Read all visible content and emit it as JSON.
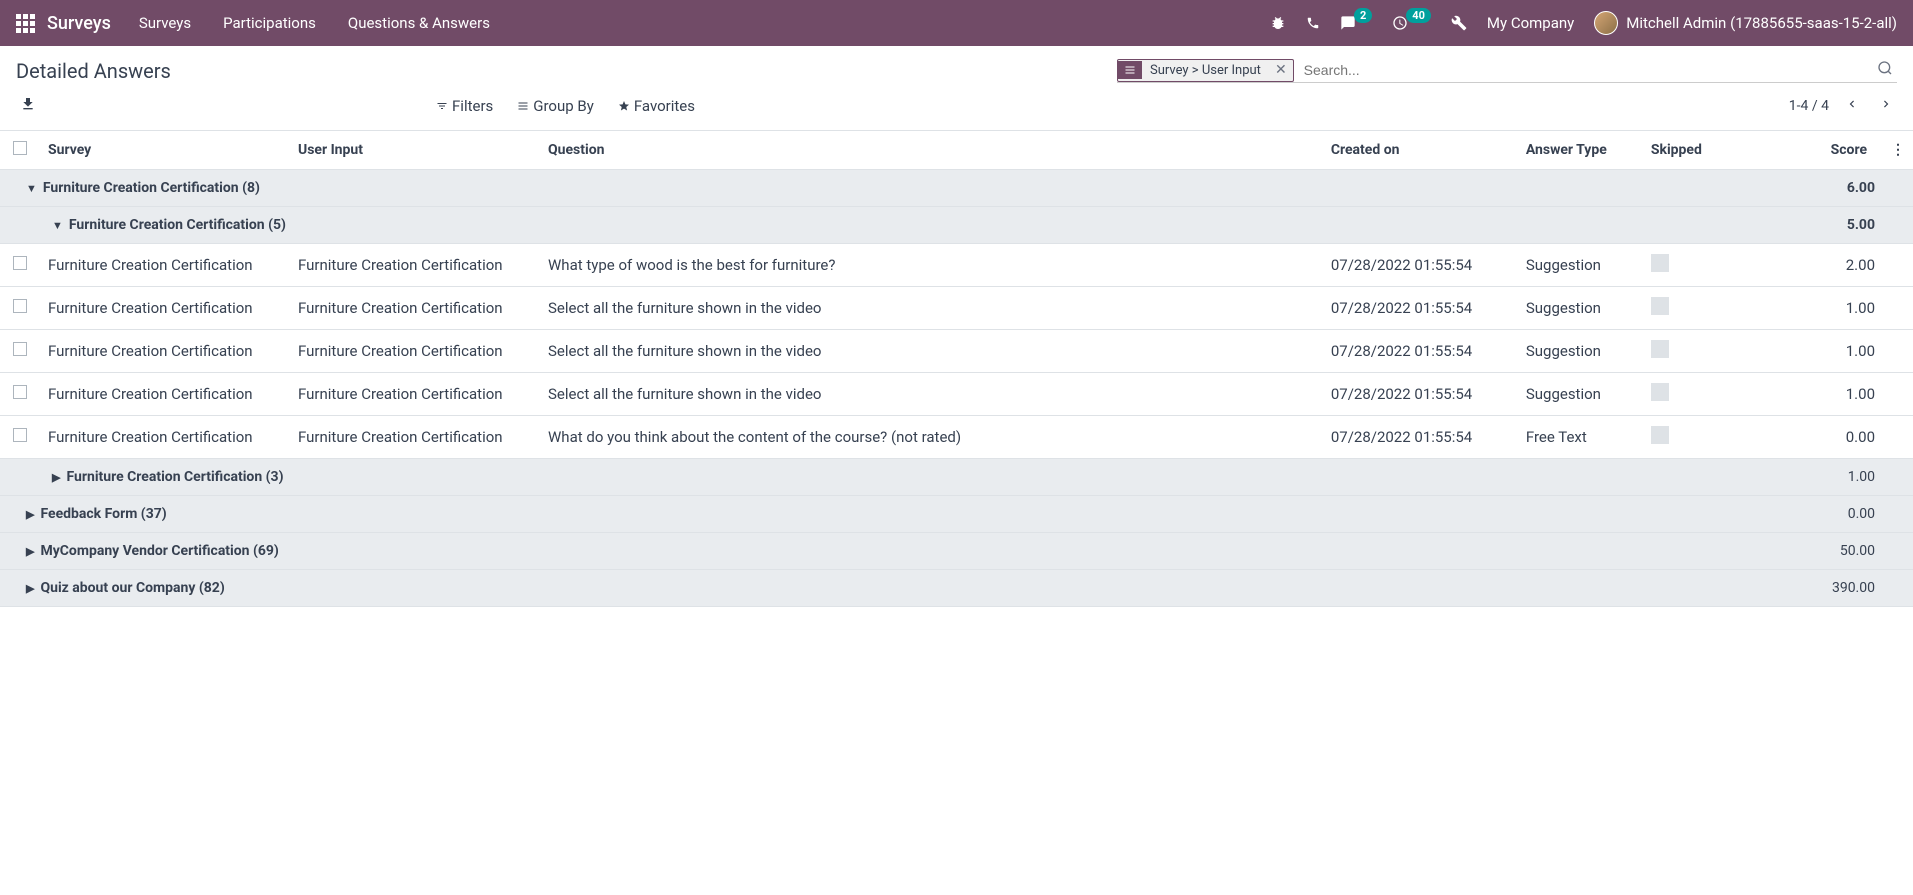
{
  "nav": {
    "brand": "Surveys",
    "items": [
      "Surveys",
      "Participations",
      "Questions & Answers"
    ],
    "messages_badge": "2",
    "activities_badge": "40",
    "company": "My Company",
    "user": "Mitchell Admin (17885655-saas-15-2-all)"
  },
  "cp": {
    "title": "Detailed Answers",
    "facet": "Survey > User Input",
    "search_placeholder": "Search...",
    "filters": "Filters",
    "groupby": "Group By",
    "favorites": "Favorites",
    "pager": "1-4 / 4"
  },
  "columns": {
    "survey": "Survey",
    "user_input": "User Input",
    "question": "Question",
    "created": "Created on",
    "answer_type": "Answer Type",
    "skipped": "Skipped",
    "score": "Score"
  },
  "groups": {
    "g1": {
      "label": "Furniture Creation Certification (8)",
      "score": "6.00"
    },
    "g1a": {
      "label": "Furniture Creation Certification (5)",
      "score": "5.00"
    },
    "g1b": {
      "label": "Furniture Creation Certification (3)",
      "score": "1.00"
    },
    "g2": {
      "label": "Feedback Form (37)",
      "score": "0.00"
    },
    "g3": {
      "label": "MyCompany Vendor Certification (69)",
      "score": "50.00"
    },
    "g4": {
      "label": "Quiz about our Company (82)",
      "score": "390.00"
    }
  },
  "rows": [
    {
      "survey": "Furniture Creation Certification",
      "user_input": "Furniture Creation Certification",
      "question": "What type of wood is the best for furniture?",
      "created": "07/28/2022 01:55:54",
      "type": "Suggestion",
      "score": "2.00"
    },
    {
      "survey": "Furniture Creation Certification",
      "user_input": "Furniture Creation Certification",
      "question": "Select all the furniture shown in the video",
      "created": "07/28/2022 01:55:54",
      "type": "Suggestion",
      "score": "1.00"
    },
    {
      "survey": "Furniture Creation Certification",
      "user_input": "Furniture Creation Certification",
      "question": "Select all the furniture shown in the video",
      "created": "07/28/2022 01:55:54",
      "type": "Suggestion",
      "score": "1.00"
    },
    {
      "survey": "Furniture Creation Certification",
      "user_input": "Furniture Creation Certification",
      "question": "Select all the furniture shown in the video",
      "created": "07/28/2022 01:55:54",
      "type": "Suggestion",
      "score": "1.00"
    },
    {
      "survey": "Furniture Creation Certification",
      "user_input": "Furniture Creation Certification",
      "question": "What do you think about the content of the course? (not rated)",
      "created": "07/28/2022 01:55:54",
      "type": "Free Text",
      "score": "0.00"
    }
  ]
}
